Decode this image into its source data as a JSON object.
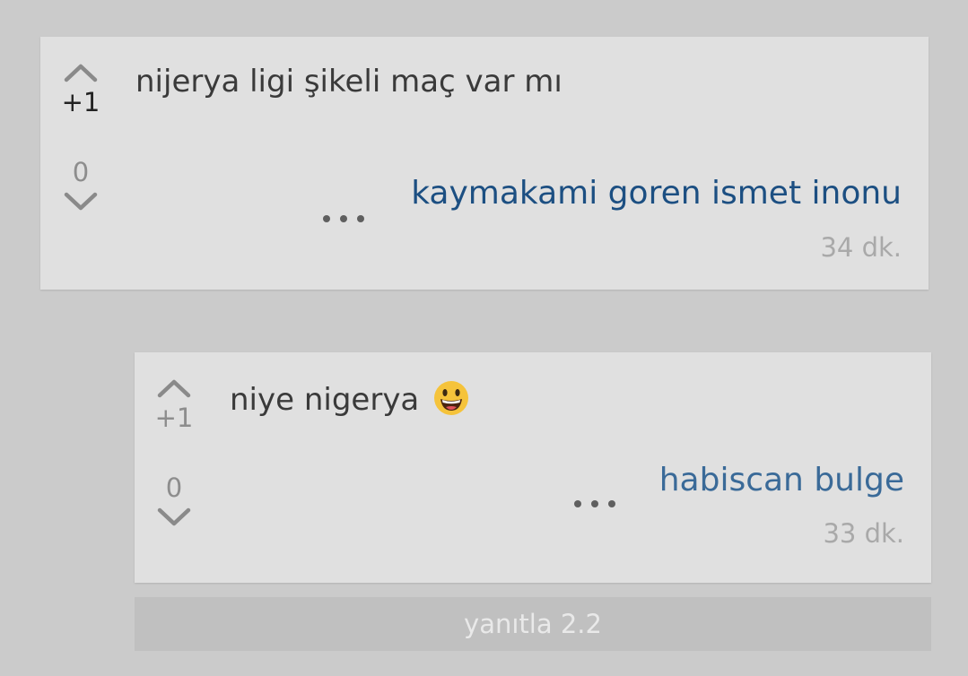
{
  "entries": [
    {
      "text": "nijerya ligi şikeli maç var mı",
      "score": "+1",
      "downvotes": "0",
      "author": "kaymakami goren ismet inonu",
      "time": "34 dk."
    },
    {
      "text": "niye nigerya",
      "emoji": "smiling-face-emoji",
      "score": "+1",
      "downvotes": "0",
      "author": "habiscan bulge",
      "time": "33 dk."
    }
  ],
  "reply_button": "yanıtla 2.2",
  "icons": {
    "upvote": "chevron-up-icon",
    "downvote": "chevron-down-icon",
    "more": "more-dots-icon"
  },
  "colors": {
    "background": "#cbcbcb",
    "card": "#e0e0e0",
    "author_link": "#1c4f82",
    "reply_button_bg": "#c0c0c0"
  }
}
